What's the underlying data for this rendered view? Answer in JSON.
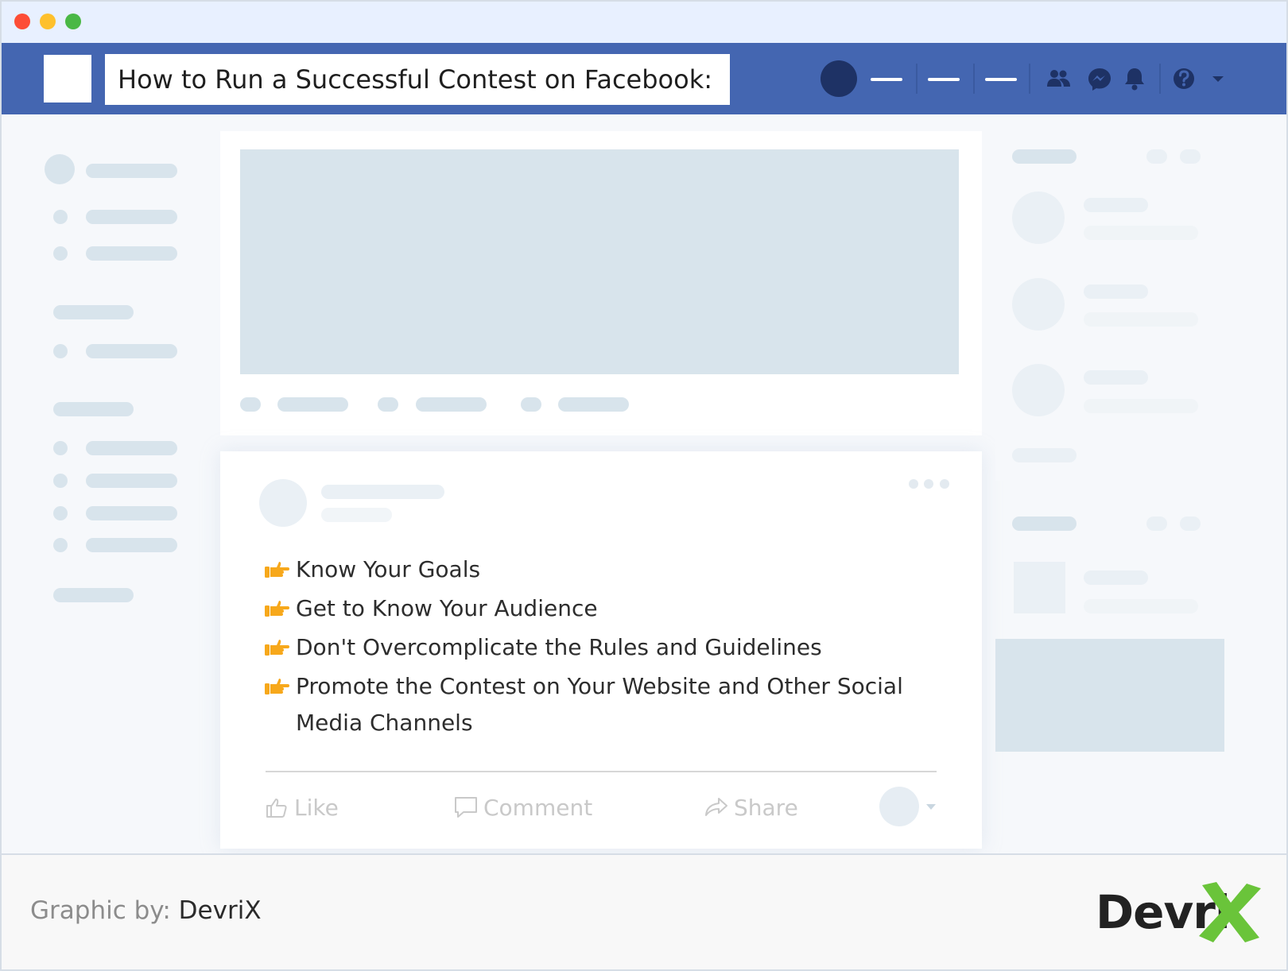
{
  "window": {
    "controls": [
      "close",
      "minimize",
      "maximize"
    ]
  },
  "navbar": {
    "search_text": "How to Run a Successful Contest on Facebook:",
    "icons": [
      "friends-icon",
      "messenger-icon",
      "bell-icon",
      "help-icon",
      "caret-down-icon"
    ]
  },
  "post": {
    "items": [
      "Know Your Goals",
      "Get to Know Your Audience",
      "Don't Overcomplicate the Rules and Guidelines",
      "Promote the Contest on Your Website and Other Social Media Channels"
    ],
    "actions": {
      "like": "Like",
      "comment": "Comment",
      "share": "Share"
    }
  },
  "footer": {
    "credit_label": "Graphic by:",
    "credit_name": "DevriX",
    "brand_text": "Devri"
  },
  "colors": {
    "navbar": "#4466b1",
    "titlebar": "#e8f0ff",
    "skeleton": "#d8e4ec",
    "accent_hand": "#f7a81b",
    "brand_x": "#6ac43a"
  }
}
